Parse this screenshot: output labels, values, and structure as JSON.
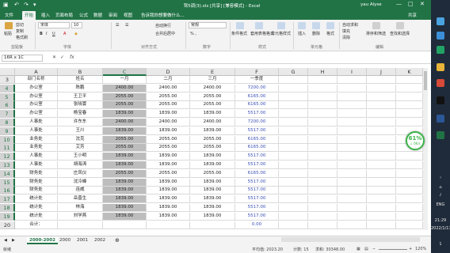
{
  "window": {
    "title": "驾5调(3).xls [共享] [兼容模式] - Excel",
    "user": "yau Alyse",
    "share_label": "共享",
    "controls": [
      "—",
      "□",
      "✕"
    ]
  },
  "ribbon_tabs": [
    "文件",
    "开始",
    "插入",
    "页面布局",
    "公式",
    "数据",
    "审阅",
    "视图",
    "告诉我你想要做什么..."
  ],
  "ribbon": {
    "clipboard": {
      "paste": "粘贴",
      "cut": "剪切",
      "copy": "复制",
      "format_painter": "格式刷",
      "group": "剪贴板"
    },
    "font": {
      "name": "宋体",
      "size": "10",
      "bold": "B",
      "italic": "I",
      "underline": "U",
      "group": "字体"
    },
    "alignment": {
      "wrap": "自动换行",
      "merge": "合并后居中",
      "group": "对齐方式"
    },
    "number": {
      "format": "常规",
      "group": "数字"
    },
    "styles": {
      "conditional": "条件格式",
      "table": "套用表格格式",
      "cell": "单元格样式",
      "group": "样式"
    },
    "cells": {
      "insert": "插入",
      "delete": "删除",
      "format": "格式",
      "group": "单元格"
    },
    "editing": {
      "autosum": "自动求和",
      "fill": "填充",
      "clear": "清除",
      "sort": "排序和筛选",
      "find": "查找和选择",
      "group": "编辑"
    }
  },
  "formula_bar": {
    "name_box": "16R x 1C",
    "fx": "fx",
    "value": ""
  },
  "grid": {
    "columns": [
      "A",
      "B",
      "C",
      "D",
      "E",
      "F",
      "G",
      "H",
      "I",
      "J",
      "K"
    ],
    "rows": [
      {
        "n": "3",
        "cells": [
          "部门名称",
          "姓名",
          "一月",
          "二月",
          "三月",
          "一季度"
        ]
      },
      {
        "n": "4",
        "cells": [
          "办公室",
          "陈鹏",
          "2400.00",
          "2400.00",
          "2400.00",
          "7200.00"
        ]
      },
      {
        "n": "5",
        "cells": [
          "办公室",
          "王卫平",
          "2055.00",
          "2055.00",
          "2055.00",
          "6165.00"
        ]
      },
      {
        "n": "6",
        "cells": [
          "办公室",
          "张晓寰",
          "2055.00",
          "2055.00",
          "2055.00",
          "6165.00"
        ]
      },
      {
        "n": "7",
        "cells": [
          "办公室",
          "杨宝春",
          "1839.00",
          "1839.00",
          "1839.00",
          "5517.00"
        ]
      },
      {
        "n": "8",
        "cells": [
          "人事处",
          "许东东",
          "2400.00",
          "2400.00",
          "2400.00",
          "7200.00"
        ]
      },
      {
        "n": "9",
        "cells": [
          "人事处",
          "王川",
          "1839.00",
          "1839.00",
          "1839.00",
          "5517.00"
        ]
      },
      {
        "n": "10",
        "cells": [
          "业务处",
          "沈克",
          "2055.00",
          "2055.00",
          "2055.00",
          "6165.00"
        ]
      },
      {
        "n": "11",
        "cells": [
          "业务处",
          "艾芳",
          "2055.00",
          "2055.00",
          "2055.00",
          "6165.00"
        ]
      },
      {
        "n": "12",
        "cells": [
          "人事处",
          "王小明",
          "1839.00",
          "1839.00",
          "1839.00",
          "5517.00"
        ]
      },
      {
        "n": "13",
        "cells": [
          "人事处",
          "胡海涛",
          "1839.00",
          "1839.00",
          "1839.00",
          "5517.00"
        ]
      },
      {
        "n": "14",
        "cells": [
          "财务处",
          "庄凤仪",
          "2055.00",
          "2055.00",
          "2055.00",
          "6165.00"
        ]
      },
      {
        "n": "15",
        "cells": [
          "财务处",
          "沈冷峰",
          "1839.00",
          "1839.00",
          "1839.00",
          "5517.00"
        ]
      },
      {
        "n": "16",
        "cells": [
          "财务处",
          "连威",
          "1839.00",
          "1839.00",
          "1839.00",
          "5517.00"
        ]
      },
      {
        "n": "17",
        "cells": [
          "统计处",
          "岳晋生",
          "1839.00",
          "1839.00",
          "1839.00",
          "5517.00"
        ]
      },
      {
        "n": "18",
        "cells": [
          "统计处",
          "林海",
          "1839.00",
          "1839.00",
          "1839.00",
          "5517.00"
        ]
      },
      {
        "n": "19",
        "cells": [
          "统计处",
          "刘学燕",
          "1839.00",
          "1839.00",
          "1839.00",
          "5517.00"
        ]
      },
      {
        "n": "20",
        "cells": [
          "合计：",
          "",
          "",
          "",
          "",
          "0.00"
        ]
      }
    ]
  },
  "sheets": {
    "tabs": [
      "2000-2002",
      "2000",
      "2001",
      "2002"
    ],
    "add": "⊕"
  },
  "status": {
    "mode": "就绪",
    "average": "平均值: 2023.20",
    "count": "计数: 15",
    "sum": "求和: 30348.00",
    "zoom": "120%"
  },
  "perf": {
    "percent": "61%",
    "speed": "↓ 0K/s"
  },
  "taskbar": {
    "lang": "ENG",
    "time": "21:29",
    "date": "2022/1/11",
    "badge": "1"
  }
}
